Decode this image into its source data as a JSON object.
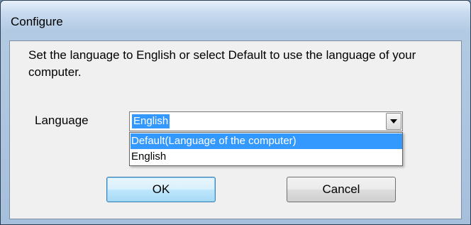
{
  "window": {
    "title": "Configure"
  },
  "dialog": {
    "message": "Set the language to English or select Default to use the language of your computer.",
    "language_label": "Language",
    "language_select": {
      "value": "English",
      "options": [
        {
          "label": "Default(Language of the computer)",
          "highlighted": true
        },
        {
          "label": "English",
          "highlighted": false
        }
      ]
    },
    "ok_label": "OK",
    "cancel_label": "Cancel"
  },
  "colors": {
    "selection": "#3399ff",
    "dialog_background": "#f0f0f0",
    "frame": "#a6bfdc"
  }
}
